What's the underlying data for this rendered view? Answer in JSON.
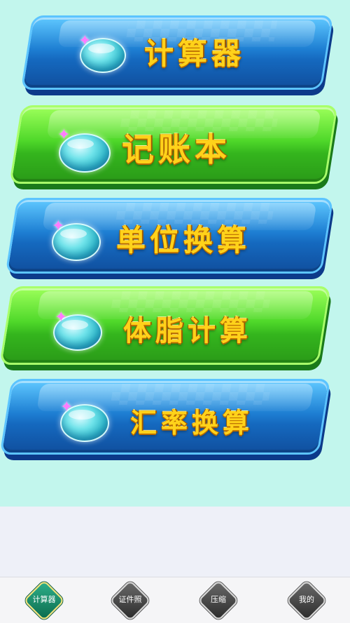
{
  "menu": {
    "buttons": [
      {
        "label": "计算器",
        "color": "blue",
        "icon": "bubble-icon"
      },
      {
        "label": "记账本",
        "color": "green",
        "icon": "bubble-icon"
      },
      {
        "label": "单位换算",
        "color": "blue",
        "icon": "bubble-icon"
      },
      {
        "label": "体脂计算",
        "color": "green",
        "icon": "bubble-icon"
      },
      {
        "label": "汇率换算",
        "color": "blue",
        "icon": "bubble-icon"
      }
    ]
  },
  "tabbar": {
    "active_index": 0,
    "tabs": [
      {
        "label": "计算器"
      },
      {
        "label": "证件照"
      },
      {
        "label": "压缩"
      },
      {
        "label": "我的"
      }
    ]
  },
  "colors": {
    "background": "#c2f6ed",
    "button_blue": "#1e7fd3",
    "button_green": "#4fd82a",
    "label_gold": "#ffd21a",
    "tab_active": "#0b6b4d",
    "tab_inactive": "#3a3a3a"
  }
}
